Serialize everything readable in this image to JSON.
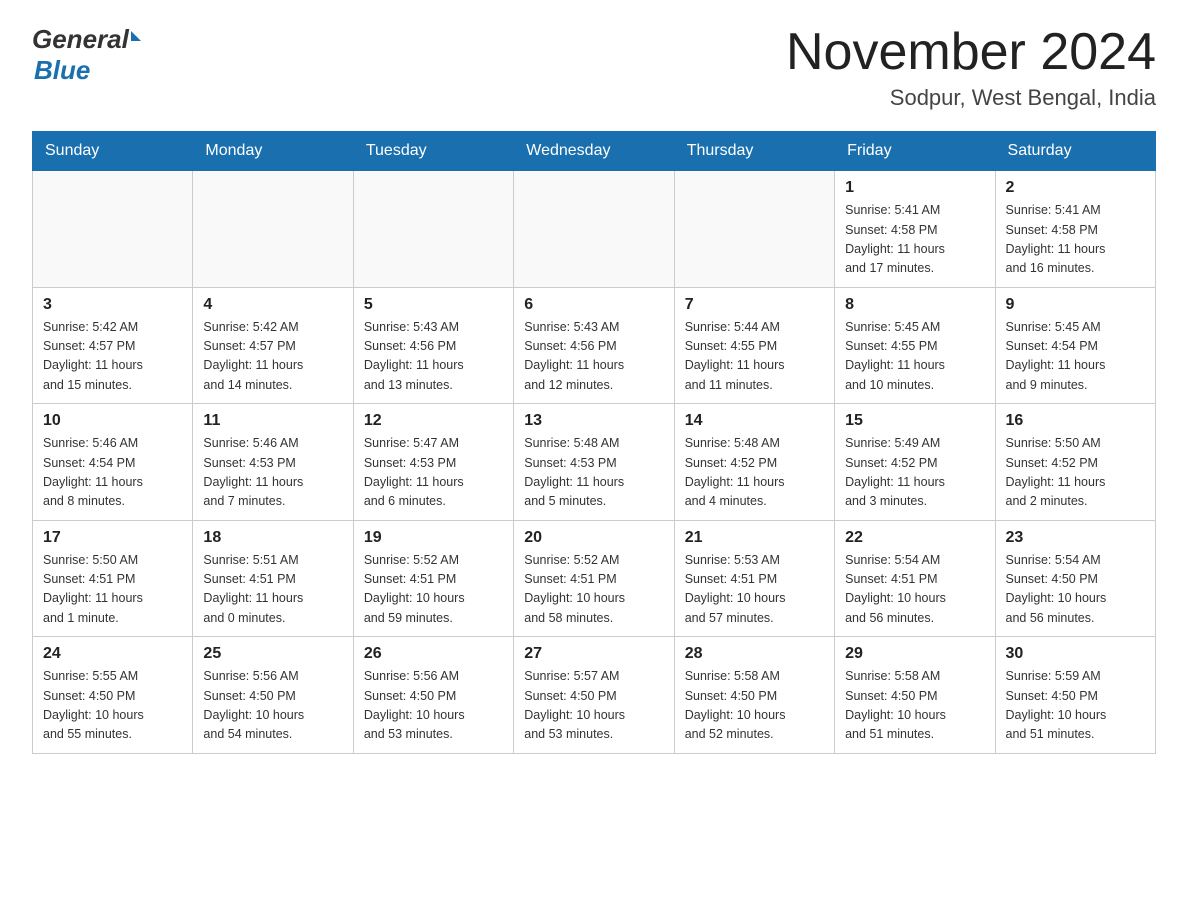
{
  "header": {
    "logo_general": "General",
    "logo_blue": "Blue",
    "title": "November 2024",
    "subtitle": "Sodpur, West Bengal, India"
  },
  "days_of_week": [
    "Sunday",
    "Monday",
    "Tuesday",
    "Wednesday",
    "Thursday",
    "Friday",
    "Saturday"
  ],
  "weeks": [
    [
      {
        "day": "",
        "info": ""
      },
      {
        "day": "",
        "info": ""
      },
      {
        "day": "",
        "info": ""
      },
      {
        "day": "",
        "info": ""
      },
      {
        "day": "",
        "info": ""
      },
      {
        "day": "1",
        "info": "Sunrise: 5:41 AM\nSunset: 4:58 PM\nDaylight: 11 hours\nand 17 minutes."
      },
      {
        "day": "2",
        "info": "Sunrise: 5:41 AM\nSunset: 4:58 PM\nDaylight: 11 hours\nand 16 minutes."
      }
    ],
    [
      {
        "day": "3",
        "info": "Sunrise: 5:42 AM\nSunset: 4:57 PM\nDaylight: 11 hours\nand 15 minutes."
      },
      {
        "day": "4",
        "info": "Sunrise: 5:42 AM\nSunset: 4:57 PM\nDaylight: 11 hours\nand 14 minutes."
      },
      {
        "day": "5",
        "info": "Sunrise: 5:43 AM\nSunset: 4:56 PM\nDaylight: 11 hours\nand 13 minutes."
      },
      {
        "day": "6",
        "info": "Sunrise: 5:43 AM\nSunset: 4:56 PM\nDaylight: 11 hours\nand 12 minutes."
      },
      {
        "day": "7",
        "info": "Sunrise: 5:44 AM\nSunset: 4:55 PM\nDaylight: 11 hours\nand 11 minutes."
      },
      {
        "day": "8",
        "info": "Sunrise: 5:45 AM\nSunset: 4:55 PM\nDaylight: 11 hours\nand 10 minutes."
      },
      {
        "day": "9",
        "info": "Sunrise: 5:45 AM\nSunset: 4:54 PM\nDaylight: 11 hours\nand 9 minutes."
      }
    ],
    [
      {
        "day": "10",
        "info": "Sunrise: 5:46 AM\nSunset: 4:54 PM\nDaylight: 11 hours\nand 8 minutes."
      },
      {
        "day": "11",
        "info": "Sunrise: 5:46 AM\nSunset: 4:53 PM\nDaylight: 11 hours\nand 7 minutes."
      },
      {
        "day": "12",
        "info": "Sunrise: 5:47 AM\nSunset: 4:53 PM\nDaylight: 11 hours\nand 6 minutes."
      },
      {
        "day": "13",
        "info": "Sunrise: 5:48 AM\nSunset: 4:53 PM\nDaylight: 11 hours\nand 5 minutes."
      },
      {
        "day": "14",
        "info": "Sunrise: 5:48 AM\nSunset: 4:52 PM\nDaylight: 11 hours\nand 4 minutes."
      },
      {
        "day": "15",
        "info": "Sunrise: 5:49 AM\nSunset: 4:52 PM\nDaylight: 11 hours\nand 3 minutes."
      },
      {
        "day": "16",
        "info": "Sunrise: 5:50 AM\nSunset: 4:52 PM\nDaylight: 11 hours\nand 2 minutes."
      }
    ],
    [
      {
        "day": "17",
        "info": "Sunrise: 5:50 AM\nSunset: 4:51 PM\nDaylight: 11 hours\nand 1 minute."
      },
      {
        "day": "18",
        "info": "Sunrise: 5:51 AM\nSunset: 4:51 PM\nDaylight: 11 hours\nand 0 minutes."
      },
      {
        "day": "19",
        "info": "Sunrise: 5:52 AM\nSunset: 4:51 PM\nDaylight: 10 hours\nand 59 minutes."
      },
      {
        "day": "20",
        "info": "Sunrise: 5:52 AM\nSunset: 4:51 PM\nDaylight: 10 hours\nand 58 minutes."
      },
      {
        "day": "21",
        "info": "Sunrise: 5:53 AM\nSunset: 4:51 PM\nDaylight: 10 hours\nand 57 minutes."
      },
      {
        "day": "22",
        "info": "Sunrise: 5:54 AM\nSunset: 4:51 PM\nDaylight: 10 hours\nand 56 minutes."
      },
      {
        "day": "23",
        "info": "Sunrise: 5:54 AM\nSunset: 4:50 PM\nDaylight: 10 hours\nand 56 minutes."
      }
    ],
    [
      {
        "day": "24",
        "info": "Sunrise: 5:55 AM\nSunset: 4:50 PM\nDaylight: 10 hours\nand 55 minutes."
      },
      {
        "day": "25",
        "info": "Sunrise: 5:56 AM\nSunset: 4:50 PM\nDaylight: 10 hours\nand 54 minutes."
      },
      {
        "day": "26",
        "info": "Sunrise: 5:56 AM\nSunset: 4:50 PM\nDaylight: 10 hours\nand 53 minutes."
      },
      {
        "day": "27",
        "info": "Sunrise: 5:57 AM\nSunset: 4:50 PM\nDaylight: 10 hours\nand 53 minutes."
      },
      {
        "day": "28",
        "info": "Sunrise: 5:58 AM\nSunset: 4:50 PM\nDaylight: 10 hours\nand 52 minutes."
      },
      {
        "day": "29",
        "info": "Sunrise: 5:58 AM\nSunset: 4:50 PM\nDaylight: 10 hours\nand 51 minutes."
      },
      {
        "day": "30",
        "info": "Sunrise: 5:59 AM\nSunset: 4:50 PM\nDaylight: 10 hours\nand 51 minutes."
      }
    ]
  ]
}
